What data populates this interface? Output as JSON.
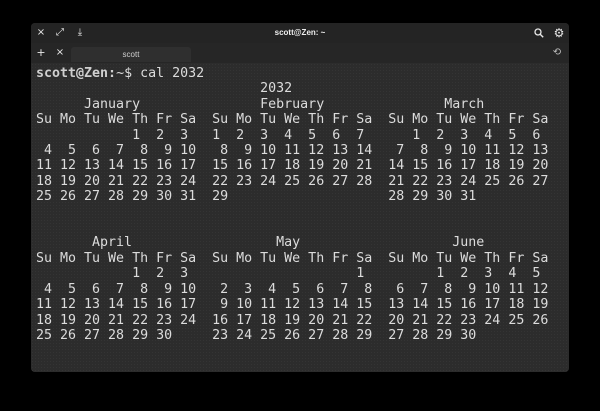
{
  "window": {
    "title": "scott@Zen: ~",
    "controls": {
      "close_glyph": "×",
      "maximize_glyph": "⤢",
      "minimize_glyph": "⤓",
      "search_glyph": "🔍",
      "settings_glyph": "⚙"
    }
  },
  "tabs": {
    "new_tab_glyph": "+",
    "close_tab_glyph": "×",
    "history_glyph": "⟲",
    "items": [
      {
        "label": "scott",
        "active": true
      }
    ]
  },
  "terminal": {
    "prompt": "scott@Zen:",
    "cwd": "~$",
    "command": " cal 2032",
    "output": [
      "                            2032",
      "      January               February               March",
      "Su Mo Tu We Th Fr Sa  Su Mo Tu We Th Fr Sa  Su Mo Tu We Th Fr Sa",
      "            1  2  3   1  2  3  4  5  6  7      1  2  3  4  5  6",
      " 4  5  6  7  8  9 10   8  9 10 11 12 13 14   7  8  9 10 11 12 13",
      "11 12 13 14 15 16 17  15 16 17 18 19 20 21  14 15 16 17 18 19 20",
      "18 19 20 21 22 23 24  22 23 24 25 26 27 28  21 22 23 24 25 26 27",
      "25 26 27 28 29 30 31  29                    28 29 30 31",
      "",
      "",
      "       April                  May                   June",
      "Su Mo Tu We Th Fr Sa  Su Mo Tu We Th Fr Sa  Su Mo Tu We Th Fr Sa",
      "            1  2  3                     1         1  2  3  4  5",
      " 4  5  6  7  8  9 10   2  3  4  5  6  7  8   6  7  8  9 10 11 12",
      "11 12 13 14 15 16 17   9 10 11 12 13 14 15  13 14 15 16 17 18 19",
      "18 19 20 21 22 23 24  16 17 18 19 20 21 22  20 21 22 23 24 25 26",
      "25 26 27 28 29 30     23 24 25 26 27 28 29  27 28 29 30"
    ]
  },
  "colors": {
    "background": "#000000",
    "titlebar": "#242424",
    "terminal_bg": "#2c2c2c",
    "text": "#dcdcdc"
  }
}
